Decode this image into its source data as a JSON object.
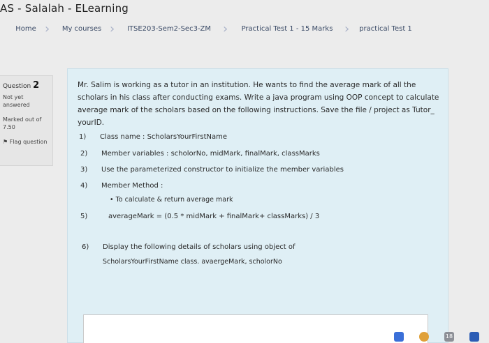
{
  "site": {
    "title": "AS - Salalah - ELearning"
  },
  "breadcrumb": [
    "Home",
    "My courses",
    "ITSE203-Sem2-Sec3-ZM",
    "Practical Test 1 - 15 Marks",
    "practical Test 1"
  ],
  "question_info": {
    "label": "Question",
    "number": "2",
    "state": "Not yet answered",
    "grade": "Marked out of 7.50",
    "flag": "Flag question"
  },
  "question": {
    "intro": "Mr. Salim is working as a tutor in an institution. He wants to find the average mark of all the scholars in his class after conducting exams. Write a java program using OOP concept to calculate average mark of the scholars based on the following instructions. Save the file / project as Tutor_ yourID.",
    "items": [
      {
        "num": "1)",
        "text": "Class name : ScholarsYourFirstName"
      },
      {
        "num": "2)",
        "text": "Member variables : scholorNo, midMark, finalMark, classMarks"
      },
      {
        "num": "3)",
        "text": "Use the parameterized constructor to initialize the member variables"
      },
      {
        "num": "4)",
        "text": "Member Method :"
      },
      {
        "num": "5)",
        "text": "averageMark = (0.5 * midMark + finalMark+ classMarks) / 3"
      },
      {
        "num": "6)",
        "text": "Display the following details of scholars using object of"
      }
    ],
    "method_bullet": "• To calculate & return average mark",
    "item6_cont": "ScholarsYourFirstName class. avaergeMark, scholorNo"
  },
  "taskbar": {
    "badge": "18"
  },
  "colors": {
    "content_bg": "#dfeff5",
    "page_bg": "#ececec",
    "breadcrumb_text": "#3a4a66"
  }
}
